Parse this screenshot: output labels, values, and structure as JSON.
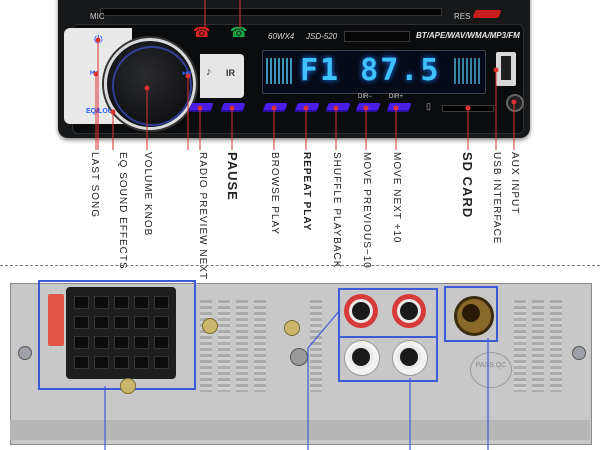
{
  "front_panel": {
    "mic_label": "MIC",
    "res_label": "RES",
    "power_label": "60WX4",
    "model_label": "JSD-520",
    "format_label": "BT/APE/WAV/WMA/MP3/FM",
    "display_text": "F1 87.5",
    "eq_button_label": "EQ/LOUD",
    "prev_glyph": "⏮",
    "next_glyph": "⏭",
    "mode_glyph": "♪",
    "ir_label": "IR",
    "dir_minus_label": "DIR−",
    "dir_plus_label": "DIR+",
    "sd_glyph": "▯"
  },
  "callouts": [
    "LAST SONG",
    "EQ SOUND EFFECTS",
    "VOLUME KNOB",
    "RADIO PREVIEW NEXT SONG",
    "PAUSE",
    "BROWSE PLAY",
    "REPEAT PLAY",
    "SHUFFLE PLAYBACK",
    "MOVE PREVIOUS−10",
    "MOVE NEXT +10",
    "SD CARD",
    "USB INTERFACE",
    "AUX INPUT"
  ],
  "rear_panel": {
    "stamp_label": "PASS QC"
  },
  "colors": {
    "accent_blue": "#3e5ad8",
    "button_purple": "#4a1ee8",
    "pointer_red": "#e03131",
    "display_cyan": "#3fc2ff"
  }
}
